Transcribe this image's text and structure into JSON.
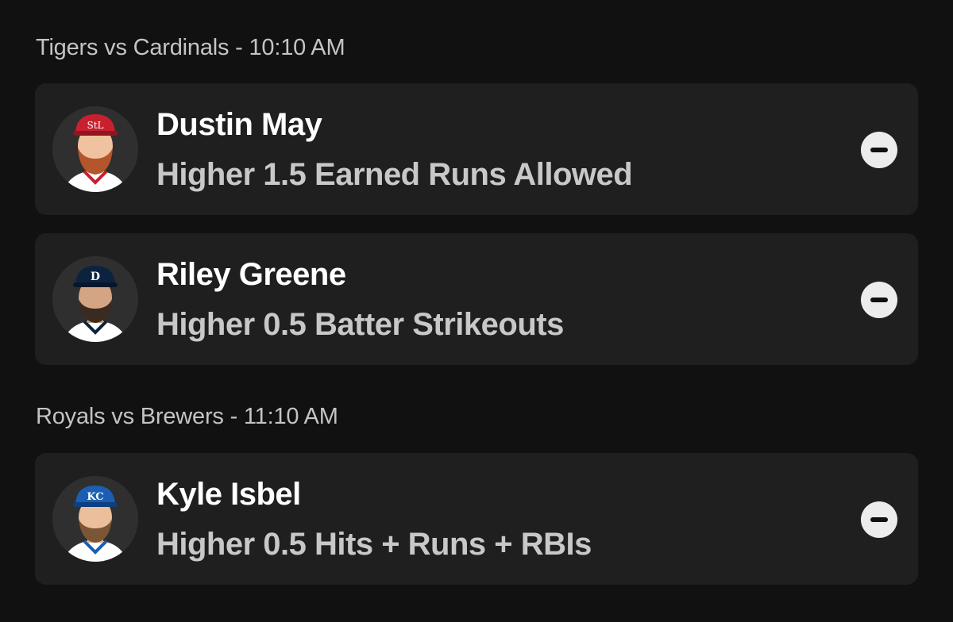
{
  "groups": [
    {
      "header": "Tigers vs Cardinals - 10:10 AM",
      "picks": [
        {
          "player": "Dustin May",
          "prop": "Higher 1.5 Earned Runs Allowed",
          "cap_color": "#c8202f",
          "beard_color": "#b5552b",
          "jersey_color": "#ffffff",
          "trim_color": "#c8202f"
        },
        {
          "player": "Riley Greene",
          "prop": "Higher 0.5 Batter Strikeouts",
          "cap_color": "#0c2340",
          "beard_color": "#3a2a20",
          "jersey_color": "#ffffff",
          "trim_color": "#0c2340"
        }
      ]
    },
    {
      "header": "Royals vs Brewers - 11:10 AM",
      "picks": [
        {
          "player": "Kyle Isbel",
          "prop": "Higher 0.5 Hits + Runs + RBIs",
          "cap_color": "#1a5fb4",
          "beard_color": "#7a5636",
          "jersey_color": "#ffffff",
          "trim_color": "#1a5fb4"
        }
      ]
    }
  ],
  "icons": {
    "remove": "minus-circle-icon",
    "avatar": "player-headshot"
  },
  "colors": {
    "background": "#111111",
    "card": "#1f1f1f",
    "header_text": "#c4c4c4",
    "prop_text": "#c8c8c8",
    "remove_button": "#ececec"
  }
}
